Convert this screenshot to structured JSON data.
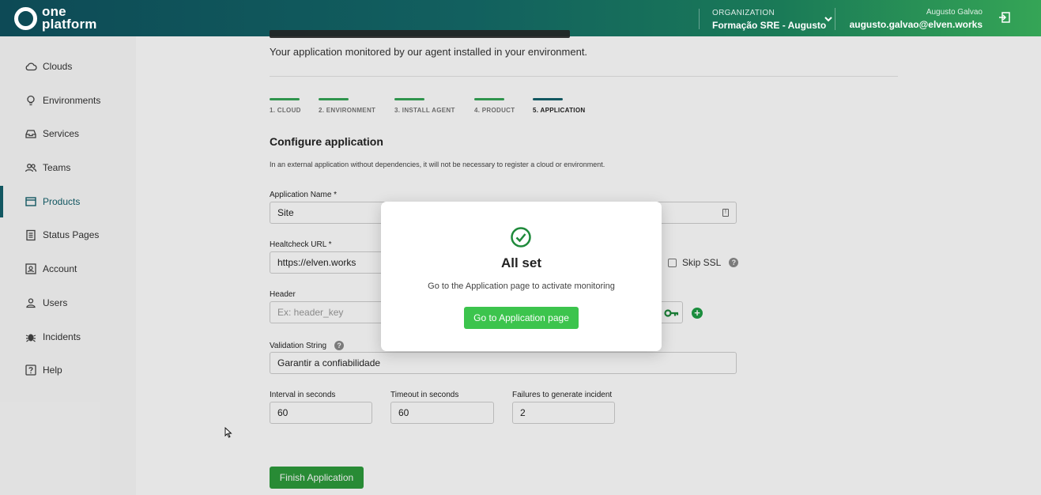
{
  "header": {
    "logo_line1": "one",
    "logo_line2": "platform",
    "org_label": "ORGANIZATION",
    "org_name": "Formação SRE - Augusto",
    "user_name": "Augusto Galvao",
    "user_email": "augusto.galvao@elven.works"
  },
  "sidebar": {
    "items": [
      {
        "label": "Clouds",
        "icon": "cloud-icon"
      },
      {
        "label": "Environments",
        "icon": "lightbulb-icon"
      },
      {
        "label": "Services",
        "icon": "inbox-icon"
      },
      {
        "label": "Teams",
        "icon": "people-icon"
      },
      {
        "label": "Products",
        "icon": "window-icon",
        "active": true
      },
      {
        "label": "Status Pages",
        "icon": "clipboard-icon"
      },
      {
        "label": "Account",
        "icon": "account-box-icon"
      },
      {
        "label": "Users",
        "icon": "person-icon"
      },
      {
        "label": "Incidents",
        "icon": "bug-icon"
      },
      {
        "label": "Help",
        "icon": "help-icon"
      }
    ]
  },
  "page": {
    "subtitle": "Your application monitored by our agent installed in your environment.",
    "steps": [
      "1. CLOUD",
      "2. ENVIRONMENT",
      "3. INSTALL AGENT",
      "4. PRODUCT",
      "5. APPLICATION"
    ],
    "section_title": "Configure application",
    "section_desc": "In an external application without dependencies, it will not be necessary to register a cloud or environment."
  },
  "form": {
    "app_name_label": "Application Name *",
    "app_name_value": "Site",
    "healthcheck_label": "Healtcheck URL *",
    "healthcheck_value": "https://elven.works",
    "skip_ssl_label": "Skip SSL",
    "header_label": "Header",
    "header_placeholder": "Ex: header_key",
    "validation_label": "Validation String",
    "validation_value": "Garantir a confiabilidade",
    "interval_label": "Interval in seconds",
    "interval_value": "60",
    "timeout_label": "Timeout in seconds",
    "timeout_value": "60",
    "failures_label": "Failures to generate incident",
    "failures_value": "2",
    "finish_label": "Finish Application"
  },
  "modal": {
    "title": "All set",
    "text": "Go to the Application page to activate monitoring",
    "button": "Go to Application page"
  },
  "colors": {
    "brand_dark": "#15616d",
    "brand_green": "#35a556",
    "button_green": "#3cc44d",
    "finish_green": "#2d9b3c"
  }
}
